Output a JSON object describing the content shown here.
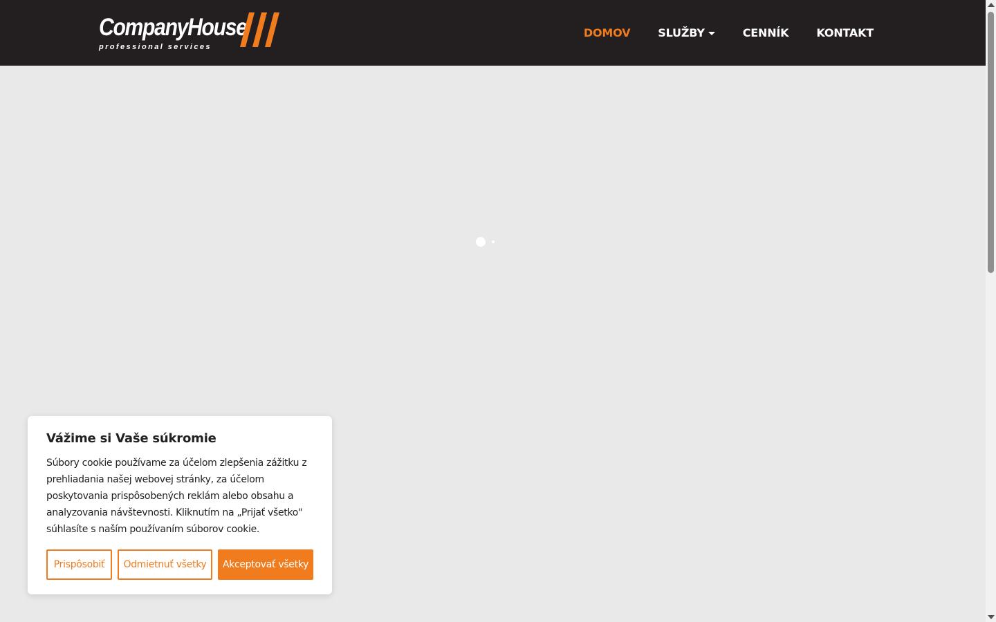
{
  "brand": {
    "name": "CompanyHouse",
    "tagline": "professional services"
  },
  "nav": {
    "items": [
      {
        "label": "DOMOV"
      },
      {
        "label": "SLUŽBY"
      },
      {
        "label": "CENNÍK"
      },
      {
        "label": "KONTAKT"
      }
    ],
    "active_index": 0
  },
  "cookie_banner": {
    "title": "Vážime si Vaše súkromie",
    "text": "Súbory cookie používame za účelom zlepšenia zážitku z prehliadania našej webovej stránky, za účelom poskytovania prispôsobených reklám alebo obsahu a analyzovania návštevnosti. Kliknutím na „Prijať všetko\" súhlasíte s naším používaním súborov cookie.",
    "buttons": {
      "customize": "Prispôsobiť",
      "reject": "Odmietnuť všetky",
      "accept": "Akceptovať všetky"
    }
  },
  "slider": {
    "slides": 2,
    "active_slide": 1
  },
  "colors": {
    "accent": "#f07c1e",
    "header_bg": "#231f20",
    "page_bg": "#e9e9e9"
  },
  "icons": {
    "dropdown": "caret-down-icon"
  }
}
